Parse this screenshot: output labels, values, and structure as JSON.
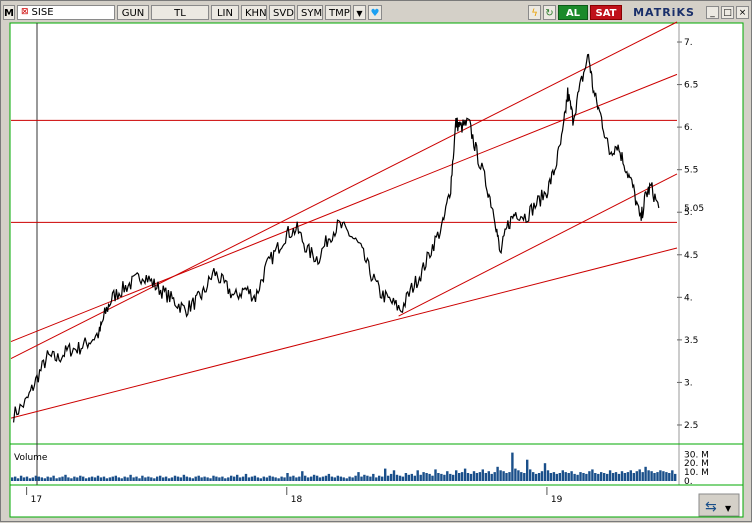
{
  "toolbar": {
    "menu_icon": "M",
    "symbol": "SISE",
    "period": "GUN",
    "currency": "TL",
    "scale": "LIN",
    "buttons": [
      "KHN",
      "SVD",
      "SYM",
      "TMP"
    ],
    "buy_label": "AL",
    "sell_label": "SAT",
    "logo": "MATRiKS",
    "window_buttons": [
      "_",
      "□",
      "×"
    ]
  },
  "chart_data": {
    "type": "line",
    "title": "",
    "symbol": "SISE",
    "line_color": "#000000",
    "trendline_color": "#cc0000",
    "y_ticks": [
      2.5,
      3,
      3.5,
      4,
      4.5,
      5,
      5.5,
      6,
      6.5,
      7
    ],
    "y_tick_labels": [
      "2.5",
      "3.",
      "3.5",
      "4.",
      "4.5",
      "5.",
      "5.5",
      "6.",
      "6.5",
      "7."
    ],
    "ylim": [
      2.3,
      7.2
    ],
    "last_value": 5.05,
    "last_value_label": "5.05",
    "x_ticks": [
      "17",
      "18",
      "19"
    ],
    "x_range": [
      2016.94,
      2019.5
    ],
    "price_series": [
      {
        "x": 2016.95,
        "y": 2.62
      },
      {
        "x": 2017.0,
        "y": 2.78
      },
      {
        "x": 2017.04,
        "y": 3.05
      },
      {
        "x": 2017.08,
        "y": 3.3
      },
      {
        "x": 2017.12,
        "y": 3.28
      },
      {
        "x": 2017.16,
        "y": 3.38
      },
      {
        "x": 2017.2,
        "y": 3.4
      },
      {
        "x": 2017.24,
        "y": 3.48
      },
      {
        "x": 2017.28,
        "y": 3.58
      },
      {
        "x": 2017.3,
        "y": 3.8
      },
      {
        "x": 2017.33,
        "y": 4.0
      },
      {
        "x": 2017.37,
        "y": 4.1
      },
      {
        "x": 2017.41,
        "y": 4.18
      },
      {
        "x": 2017.45,
        "y": 4.27
      },
      {
        "x": 2017.49,
        "y": 4.15
      },
      {
        "x": 2017.53,
        "y": 4.05
      },
      {
        "x": 2017.57,
        "y": 3.95
      },
      {
        "x": 2017.61,
        "y": 3.85
      },
      {
        "x": 2017.65,
        "y": 3.95
      },
      {
        "x": 2017.68,
        "y": 4.05
      },
      {
        "x": 2017.72,
        "y": 4.3
      },
      {
        "x": 2017.76,
        "y": 4.15
      },
      {
        "x": 2017.8,
        "y": 4.0
      },
      {
        "x": 2017.84,
        "y": 4.1
      },
      {
        "x": 2017.88,
        "y": 4.0
      },
      {
        "x": 2017.92,
        "y": 4.35
      },
      {
        "x": 2017.96,
        "y": 4.55
      },
      {
        "x": 2018.0,
        "y": 4.75
      },
      {
        "x": 2018.04,
        "y": 4.8
      },
      {
        "x": 2018.08,
        "y": 4.55
      },
      {
        "x": 2018.12,
        "y": 4.45
      },
      {
        "x": 2018.16,
        "y": 4.7
      },
      {
        "x": 2018.2,
        "y": 4.85
      },
      {
        "x": 2018.24,
        "y": 4.75
      },
      {
        "x": 2018.28,
        "y": 4.6
      },
      {
        "x": 2018.32,
        "y": 4.3
      },
      {
        "x": 2018.36,
        "y": 4.05
      },
      {
        "x": 2018.4,
        "y": 3.95
      },
      {
        "x": 2018.44,
        "y": 3.85
      },
      {
        "x": 2018.48,
        "y": 4.1
      },
      {
        "x": 2018.52,
        "y": 4.3
      },
      {
        "x": 2018.56,
        "y": 4.6
      },
      {
        "x": 2018.6,
        "y": 4.85
      },
      {
        "x": 2018.63,
        "y": 5.3
      },
      {
        "x": 2018.65,
        "y": 6.05
      },
      {
        "x": 2018.67,
        "y": 6.0
      },
      {
        "x": 2018.7,
        "y": 6.05
      },
      {
        "x": 2018.73,
        "y": 5.7
      },
      {
        "x": 2018.77,
        "y": 5.3
      },
      {
        "x": 2018.8,
        "y": 4.95
      },
      {
        "x": 2018.82,
        "y": 4.5
      },
      {
        "x": 2018.85,
        "y": 4.85
      },
      {
        "x": 2018.88,
        "y": 5.0
      },
      {
        "x": 2018.92,
        "y": 4.95
      },
      {
        "x": 2018.96,
        "y": 5.1
      },
      {
        "x": 2019.0,
        "y": 5.25
      },
      {
        "x": 2019.03,
        "y": 5.5
      },
      {
        "x": 2019.06,
        "y": 5.9
      },
      {
        "x": 2019.08,
        "y": 6.4
      },
      {
        "x": 2019.1,
        "y": 6.1
      },
      {
        "x": 2019.13,
        "y": 6.5
      },
      {
        "x": 2019.16,
        "y": 6.85
      },
      {
        "x": 2019.18,
        "y": 6.4
      },
      {
        "x": 2019.21,
        "y": 6.1
      },
      {
        "x": 2019.24,
        "y": 5.7
      },
      {
        "x": 2019.27,
        "y": 5.8
      },
      {
        "x": 2019.3,
        "y": 5.55
      },
      {
        "x": 2019.33,
        "y": 5.3
      },
      {
        "x": 2019.36,
        "y": 4.9
      },
      {
        "x": 2019.38,
        "y": 5.2
      },
      {
        "x": 2019.4,
        "y": 5.3
      },
      {
        "x": 2019.43,
        "y": 5.05
      }
    ],
    "trendlines": [
      {
        "x1": 2016.94,
        "y1": 2.58,
        "x2": 2019.5,
        "y2": 4.58
      },
      {
        "x1": 2018.43,
        "y1": 3.78,
        "x2": 2019.5,
        "y2": 5.45
      },
      {
        "x1": 2016.94,
        "y1": 3.28,
        "x2": 2019.5,
        "y2": 7.35
      },
      {
        "x1": 2016.94,
        "y1": 3.48,
        "x2": 2019.5,
        "y2": 6.62
      }
    ],
    "horizontal_lines": [
      6.08,
      4.88
    ],
    "volume_panel": {
      "label": "Volume",
      "y_tick_labels": [
        "30. M",
        "20. M",
        "10. M",
        "0."
      ],
      "y_ticks": [
        30,
        20,
        10,
        0
      ],
      "ylim": [
        0,
        36
      ],
      "color": "#1a4f8a",
      "values": [
        4,
        5,
        3,
        6,
        4,
        5,
        3,
        4,
        6,
        5,
        4,
        3,
        5,
        4,
        6,
        3,
        4,
        5,
        7,
        4,
        3,
        5,
        4,
        6,
        5,
        3,
        4,
        5,
        4,
        6,
        4,
        5,
        3,
        4,
        5,
        6,
        4,
        3,
        5,
        4,
        7,
        4,
        5,
        3,
        6,
        4,
        5,
        4,
        3,
        5,
        6,
        4,
        5,
        3,
        4,
        6,
        5,
        4,
        7,
        5,
        4,
        3,
        5,
        6,
        4,
        5,
        4,
        3,
        6,
        5,
        4,
        5,
        3,
        4,
        6,
        5,
        7,
        4,
        5,
        8,
        4,
        5,
        6,
        4,
        3,
        5,
        4,
        6,
        5,
        4,
        3,
        5,
        4,
        9,
        5,
        6,
        4,
        5,
        11,
        6,
        4,
        5,
        7,
        6,
        4,
        5,
        6,
        8,
        5,
        4,
        6,
        5,
        4,
        3,
        5,
        4,
        6,
        10,
        5,
        7,
        6,
        5,
        8,
        4,
        6,
        5,
        14,
        6,
        8,
        12,
        7,
        6,
        5,
        9,
        7,
        8,
        6,
        12,
        7,
        10,
        9,
        8,
        6,
        13,
        9,
        8,
        7,
        11,
        8,
        7,
        12,
        9,
        10,
        14,
        9,
        8,
        11,
        9,
        10,
        13,
        9,
        11,
        8,
        10,
        16,
        12,
        11,
        9,
        10,
        32,
        14,
        12,
        10,
        9,
        24,
        13,
        10,
        8,
        9,
        11,
        20,
        12,
        9,
        10,
        8,
        9,
        12,
        10,
        9,
        11,
        8,
        7,
        10,
        9,
        8,
        11,
        13,
        9,
        8,
        10,
        9,
        8,
        12,
        9,
        10,
        8,
        11,
        9,
        10,
        12,
        9,
        11,
        13,
        10,
        16,
        12,
        11,
        9,
        10,
        12,
        11,
        10,
        9,
        12,
        8
      ]
    }
  }
}
